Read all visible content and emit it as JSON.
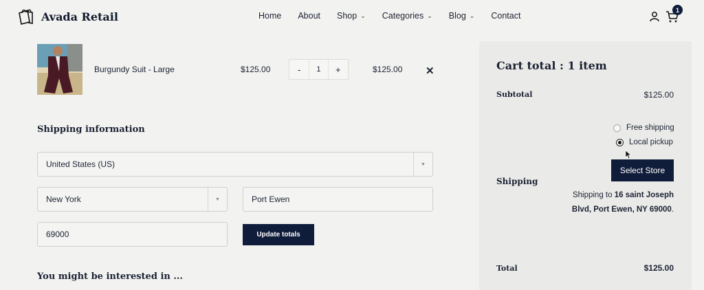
{
  "header": {
    "brand": "Avada Retail",
    "nav": [
      {
        "label": "Home",
        "dropdown": false
      },
      {
        "label": "About",
        "dropdown": false
      },
      {
        "label": "Shop",
        "dropdown": true
      },
      {
        "label": "Categories",
        "dropdown": true
      },
      {
        "label": "Blog",
        "dropdown": true
      },
      {
        "label": "Contact",
        "dropdown": false
      }
    ],
    "cart_count": "1",
    "icons": [
      "user-icon",
      "cart-icon"
    ]
  },
  "cart_item": {
    "name": "Burgundy Suit - Large",
    "price": "$125.00",
    "quantity": "1",
    "qty_minus": "-",
    "qty_plus": "+",
    "subtotal": "$125.00",
    "remove": "✕"
  },
  "shipping_form": {
    "title": "Shipping information",
    "country": "United States (US)",
    "state": "New York",
    "city": "Port Ewen",
    "zip": "69000",
    "update_button": "Update totals"
  },
  "interest_title": "You might be interested in ...",
  "cart_total": {
    "title": "Cart total : 1 item",
    "subtotal_label": "Subtotal",
    "subtotal_value": "$125.00",
    "shipping_label": "Shipping",
    "options": [
      {
        "label": "Free shipping",
        "selected": false
      },
      {
        "label": "Local pickup",
        "selected": true
      }
    ],
    "select_store_button": "Select Store",
    "ship_to_prefix": "Shipping to ",
    "ship_to_address": "16 saint Joseph Blvd, Port Ewen, NY 69000",
    "ship_to_suffix": ".",
    "total_label": "Total",
    "total_value": "$125.00"
  },
  "colors": {
    "accent": "#0f1c3a",
    "background": "#f2f2f0",
    "panel": "#eaeae8"
  }
}
